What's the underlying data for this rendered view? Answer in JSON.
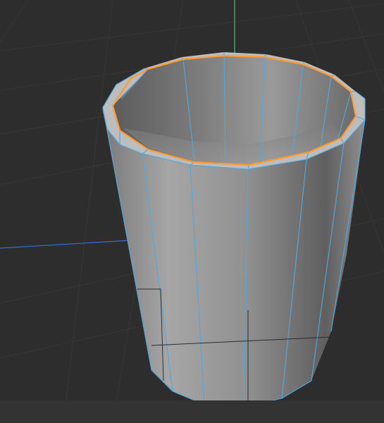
{
  "viewport": {
    "background_color": "#2d2d2d",
    "grid_color": "#363636",
    "grid_shadow_color": "#222222",
    "axis_y_color": "#3cc46c",
    "axis_x_color": "#2f6fd8",
    "bottom_bar_color": "#333333"
  },
  "model": {
    "object_type": "cylinder",
    "state": "edit-mode",
    "selection": "top-rim-edge-loop",
    "selection_color": "#ff9a2e",
    "wire_color": "#4fa9df",
    "faces_visible": 12
  }
}
